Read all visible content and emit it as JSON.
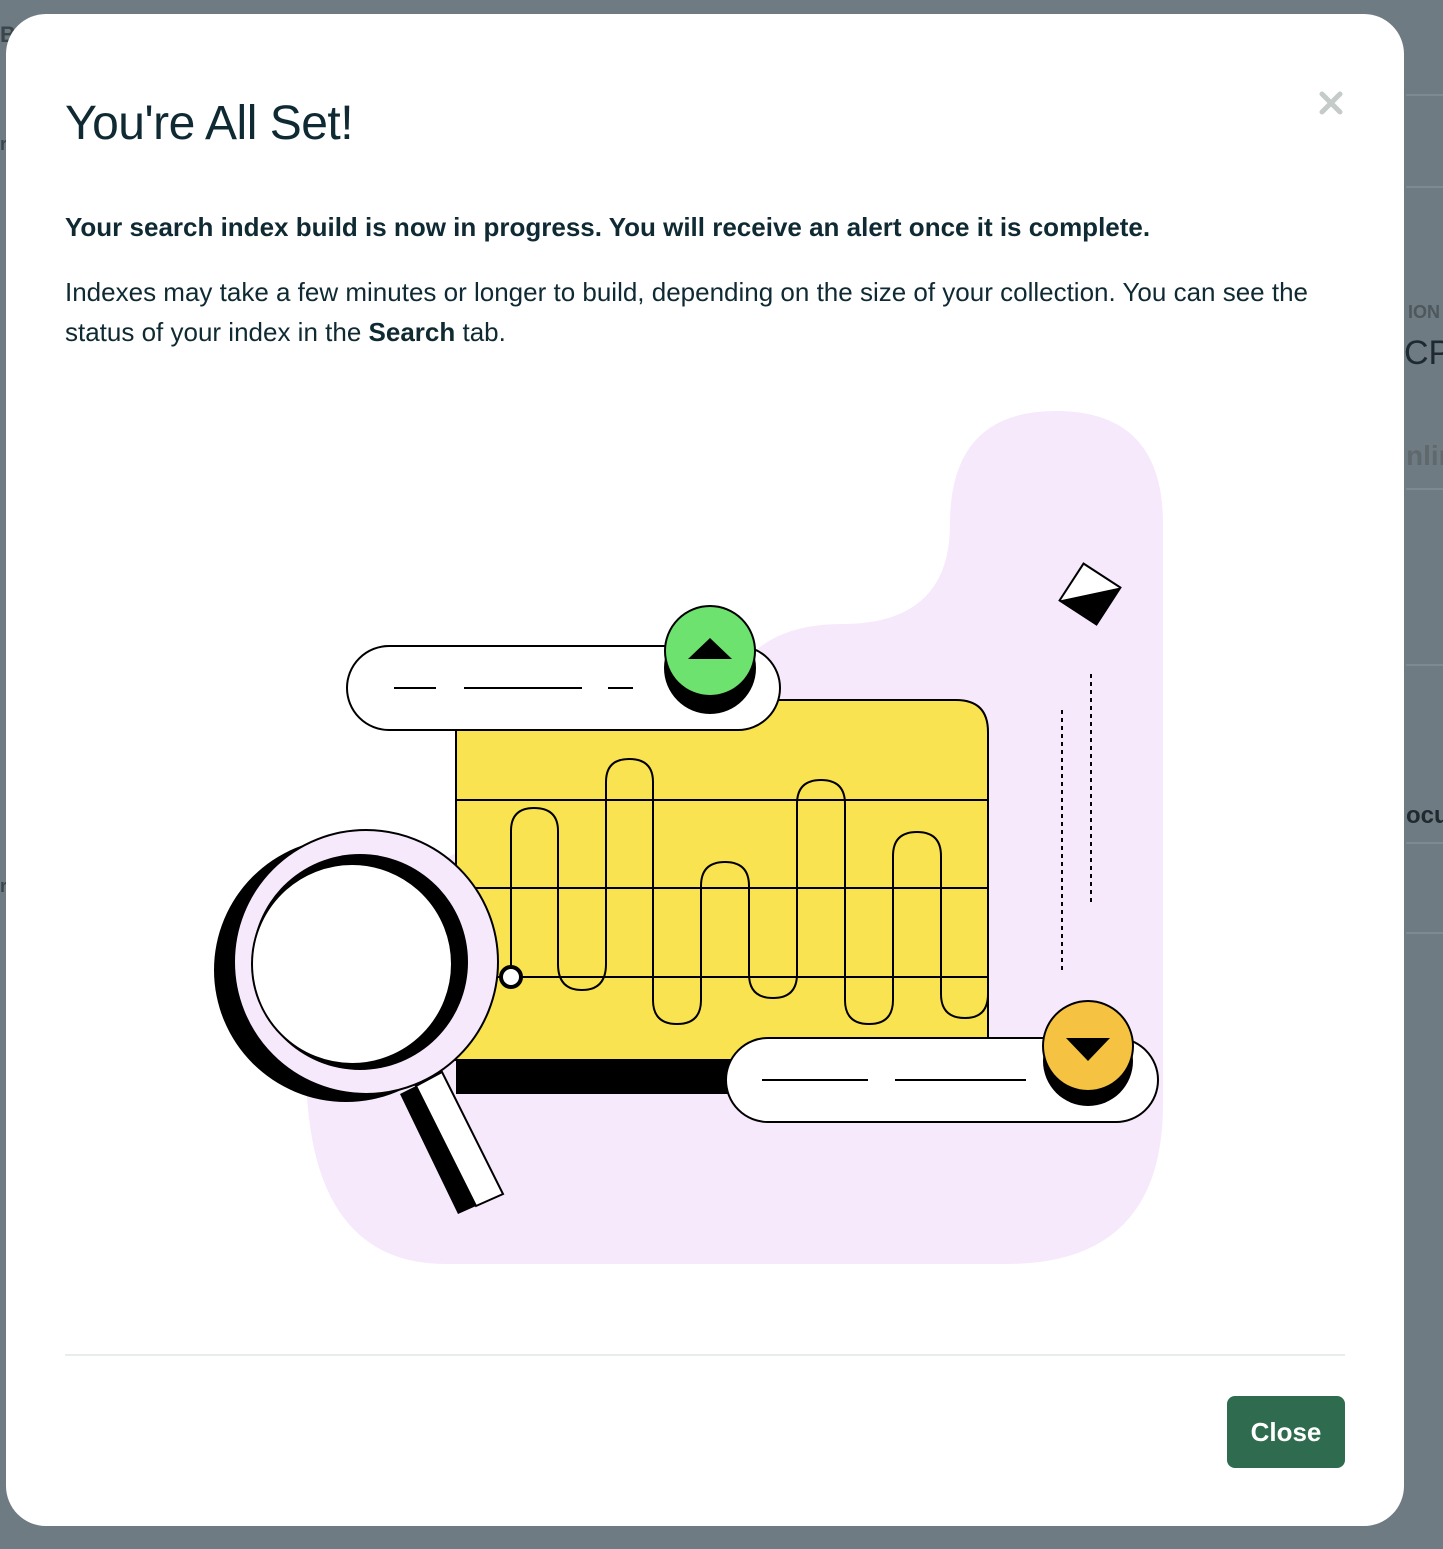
{
  "background": {
    "fragments": [
      "Bi",
      "r",
      "ION",
      "CP",
      "nlir",
      "ocu",
      "r"
    ]
  },
  "modal": {
    "title": "You're All Set!",
    "close_icon": "close-icon",
    "lead": "Your search index build is now in progress. You will receive an alert once it is complete.",
    "description_part1": "Indexes may take a few minutes or longer to build, depending on the size of your collection. You can see the status of your index in the ",
    "description_bold": "Search",
    "description_part2": " tab.",
    "illustration": "search-index-illustration",
    "close_button_label": "Close",
    "colors": {
      "accent_green": "#2f6b4f",
      "blob_lavender": "#f5e9fb",
      "chart_yellow": "#fae350",
      "up_badge_green": "#6de26f",
      "down_badge_orange": "#f5c242",
      "text_dark": "#0f2a33"
    }
  }
}
